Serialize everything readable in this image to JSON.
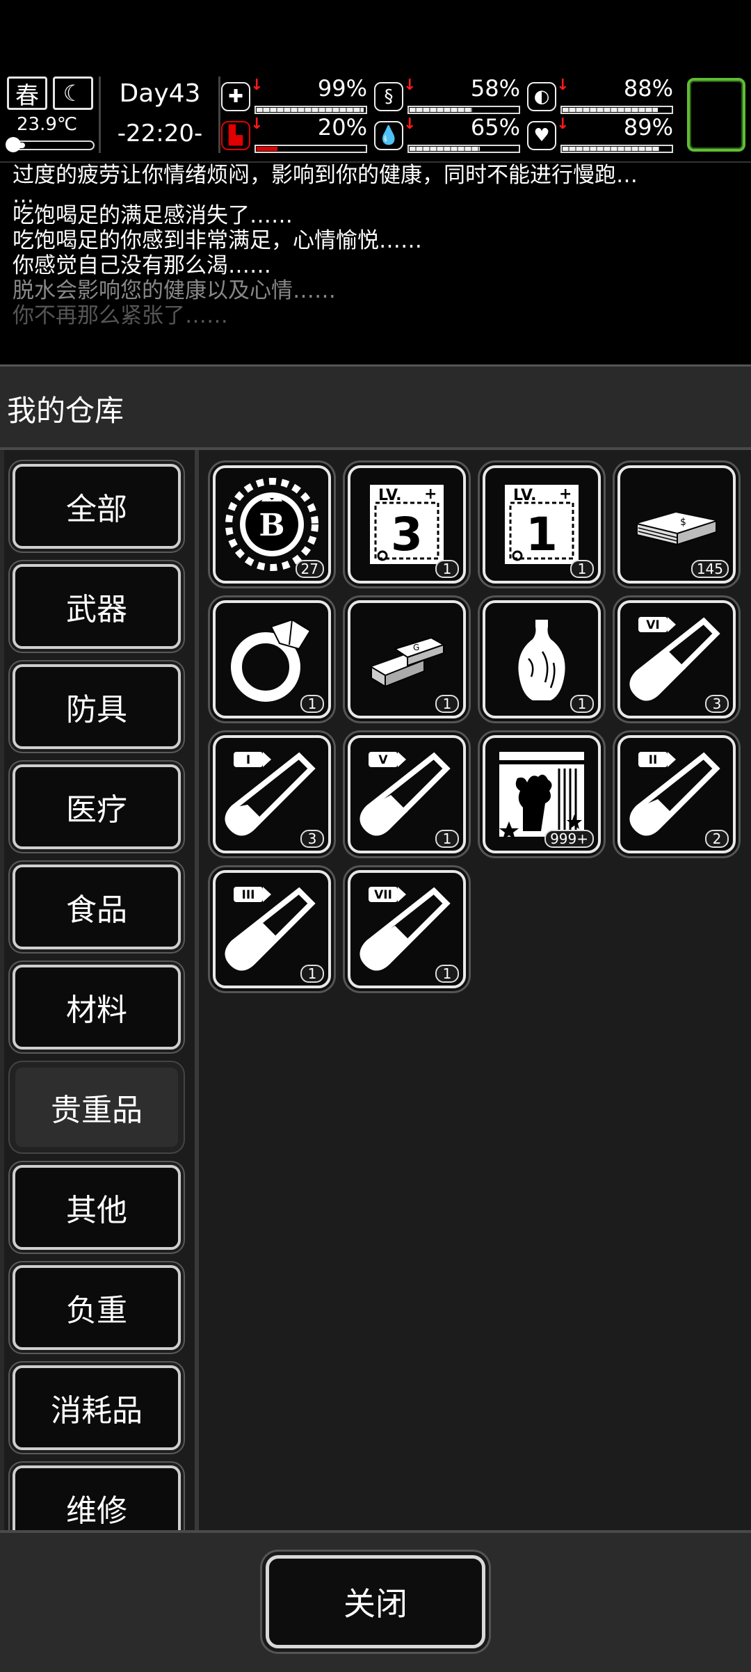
{
  "hud": {
    "season": "春",
    "temperature": "23.9℃",
    "temperature_level": 0.2,
    "day": "Day43",
    "time": "-22:20-",
    "stats": [
      {
        "icon": "medkit-icon",
        "value": "99%",
        "level": 0.99
      },
      {
        "icon": "stomach-icon",
        "value": "58%",
        "level": 0.58
      },
      {
        "icon": "pill-icon",
        "value": "88%",
        "level": 0.88
      },
      {
        "icon": "boot-icon",
        "value": "20%",
        "level": 0.2
      },
      {
        "icon": "water-drop-icon",
        "value": "65%",
        "level": 0.65
      },
      {
        "icon": "heart-icon",
        "value": "89%",
        "level": 0.89
      }
    ]
  },
  "log": [
    "过度的疲劳让你情绪烦闷，影响到你的健康，同时不能进行慢跑…",
    "…",
    "吃饱喝足的满足感消失了……",
    "吃饱喝足的你感到非常满足，心情愉悦……",
    "你感觉自己没有那么渴……",
    "脱水会影响您的健康以及心情……",
    "你不再那么紧张了……"
  ],
  "warehouse": {
    "title": "我的仓库",
    "categories": [
      "全部",
      "武器",
      "防具",
      "医疗",
      "食品",
      "材料",
      "贵重品",
      "其他",
      "负重",
      "消耗品",
      "维修"
    ],
    "active_category": "贵重品",
    "items": [
      {
        "icon": "bitcoin-chip-icon",
        "count": "27"
      },
      {
        "icon": "lv3-ticket-icon",
        "count": "1",
        "label": "3"
      },
      {
        "icon": "lv1-ticket-icon",
        "count": "1",
        "label": "1"
      },
      {
        "icon": "cash-stack-icon",
        "count": "145"
      },
      {
        "icon": "diamond-ring-icon",
        "count": "1"
      },
      {
        "icon": "gold-bars-icon",
        "count": "1"
      },
      {
        "icon": "vase-icon",
        "count": "1"
      },
      {
        "icon": "test-tube-vi-icon",
        "count": "3",
        "label": "VI"
      },
      {
        "icon": "test-tube-i-icon",
        "count": "3",
        "label": "I"
      },
      {
        "icon": "test-tube-v-icon",
        "count": "1",
        "label": "V"
      },
      {
        "icon": "coral-card-icon",
        "count": "999+"
      },
      {
        "icon": "test-tube-ii-icon",
        "count": "2",
        "label": "II"
      },
      {
        "icon": "test-tube-iii-icon",
        "count": "1",
        "label": "III"
      },
      {
        "icon": "test-tube-vii-icon",
        "count": "1",
        "label": "VII"
      }
    ]
  },
  "close_label": "关闭"
}
